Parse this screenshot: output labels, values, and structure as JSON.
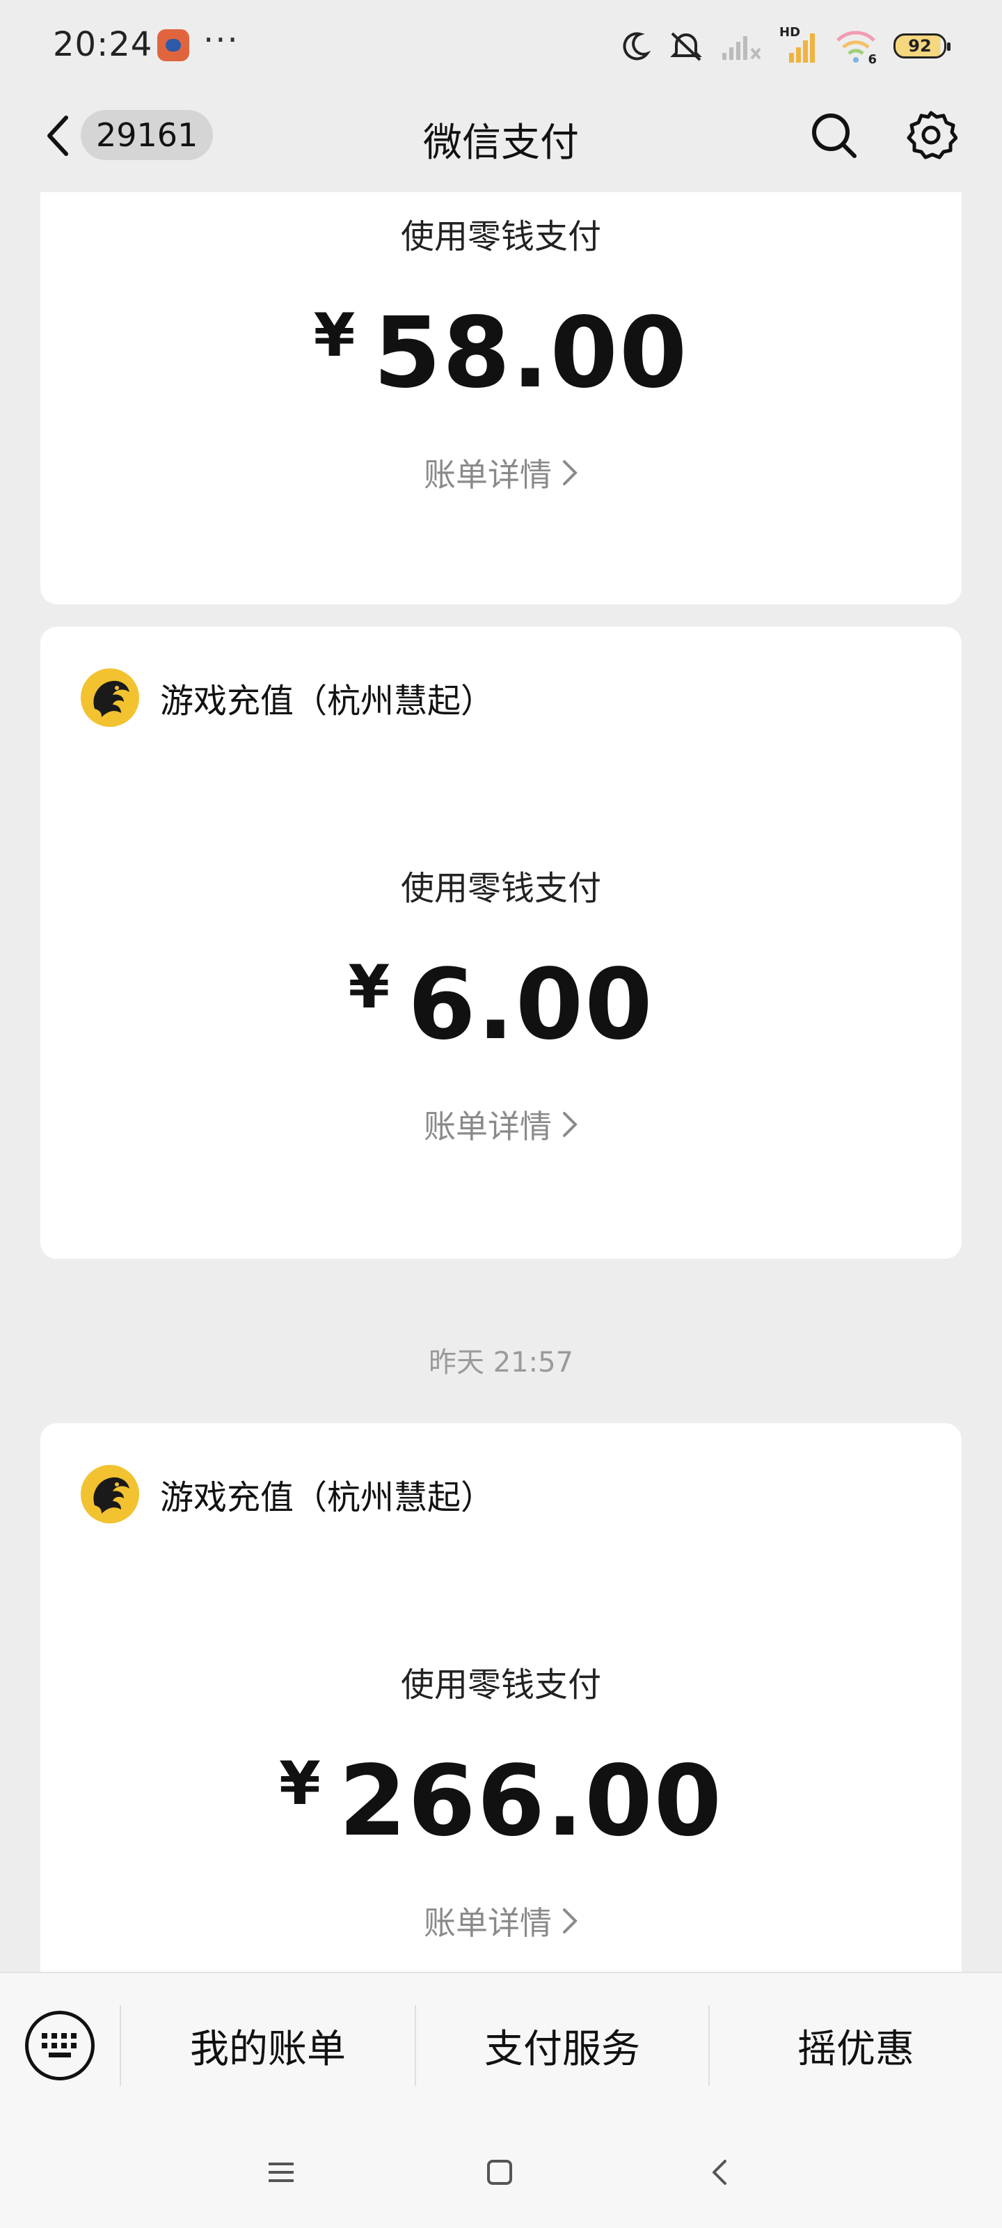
{
  "status_bar": {
    "time": "20:24",
    "dots": "···",
    "battery": "92",
    "network_label": "HD",
    "wifi_label": "6"
  },
  "nav": {
    "badge_count": "29161",
    "title": "微信支付"
  },
  "cards": [
    {
      "merchant": "",
      "pay_method": "使用零钱支付",
      "currency": "¥",
      "amount": "58.00",
      "detail_label": "账单详情"
    },
    {
      "merchant": "游戏充值（杭州慧起）",
      "pay_method": "使用零钱支付",
      "currency": "¥",
      "amount": "6.00",
      "detail_label": "账单详情"
    },
    {
      "merchant": "游戏充值（杭州慧起）",
      "pay_method": "使用零钱支付",
      "currency": "¥",
      "amount": "266.00",
      "detail_label": "账单详情"
    }
  ],
  "timestamp": "昨天 21:57",
  "bottom_menu": {
    "items": [
      "我的账单",
      "支付服务",
      "摇优惠"
    ]
  },
  "colors": {
    "background": "#ededed",
    "card": "#ffffff",
    "merchant_logo": "#f2c230",
    "muted_text": "#8a8a8a"
  },
  "icons": {
    "back": "chevron-left-icon",
    "search": "search-icon",
    "settings": "gear-icon",
    "keyboard": "keyboard-icon",
    "merchant_logo": "dragon-logo-icon",
    "detail_arrow": "chevron-right-icon"
  }
}
